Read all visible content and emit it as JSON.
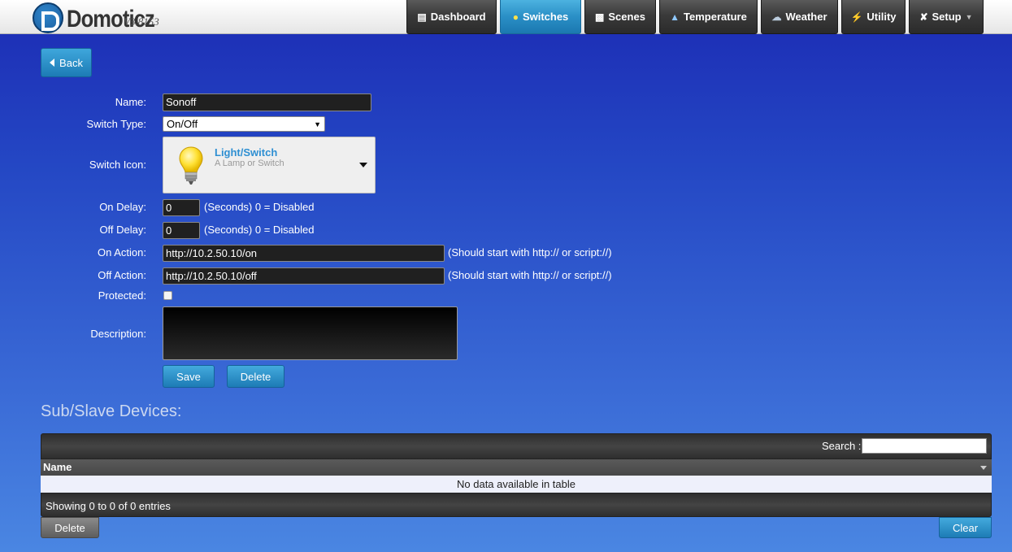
{
  "app": {
    "name": "Domoticz",
    "version": "V3.8153"
  },
  "nav": {
    "items": [
      {
        "label": "Dashboard",
        "icon": "dashboard-icon"
      },
      {
        "label": "Switches",
        "icon": "lightbulb-icon",
        "active": true
      },
      {
        "label": "Scenes",
        "icon": "clapperboard-icon"
      },
      {
        "label": "Temperature",
        "icon": "thermometer-icon"
      },
      {
        "label": "Weather",
        "icon": "cloud-rain-icon"
      },
      {
        "label": "Utility",
        "icon": "meter-icon"
      },
      {
        "label": "Setup",
        "icon": "tools-icon"
      }
    ]
  },
  "back_label": "Back",
  "form": {
    "name_label": "Name:",
    "name_value": "Sonoff",
    "switch_type_label": "Switch Type:",
    "switch_type_value": "On/Off",
    "switch_icon_label": "Switch Icon:",
    "switch_icon_name": "Light/Switch",
    "switch_icon_desc": "A Lamp or Switch",
    "on_delay_label": "On Delay:",
    "on_delay_value": "0",
    "off_delay_label": "Off Delay:",
    "off_delay_value": "0",
    "delay_hint": "(Seconds) 0 = Disabled",
    "on_action_label": "On Action:",
    "on_action_value": "http://10.2.50.10/on",
    "off_action_label": "Off Action:",
    "off_action_value": "http://10.2.50.10/off",
    "action_hint": "(Should start with http:// or script://)",
    "protected_label": "Protected:",
    "description_label": "Description:",
    "save_label": "Save",
    "delete_label": "Delete"
  },
  "subslave": {
    "title": "Sub/Slave Devices:",
    "search_label": "Search :",
    "column_name": "Name",
    "empty_text": "No data available in table",
    "info_text": "Showing 0 to 0 of 0 entries",
    "delete_label": "Delete",
    "clear_label": "Clear"
  },
  "colors": {
    "accent": "#1d7bb5",
    "active_nav": "#2a8fc6",
    "background": "#2447c4"
  }
}
